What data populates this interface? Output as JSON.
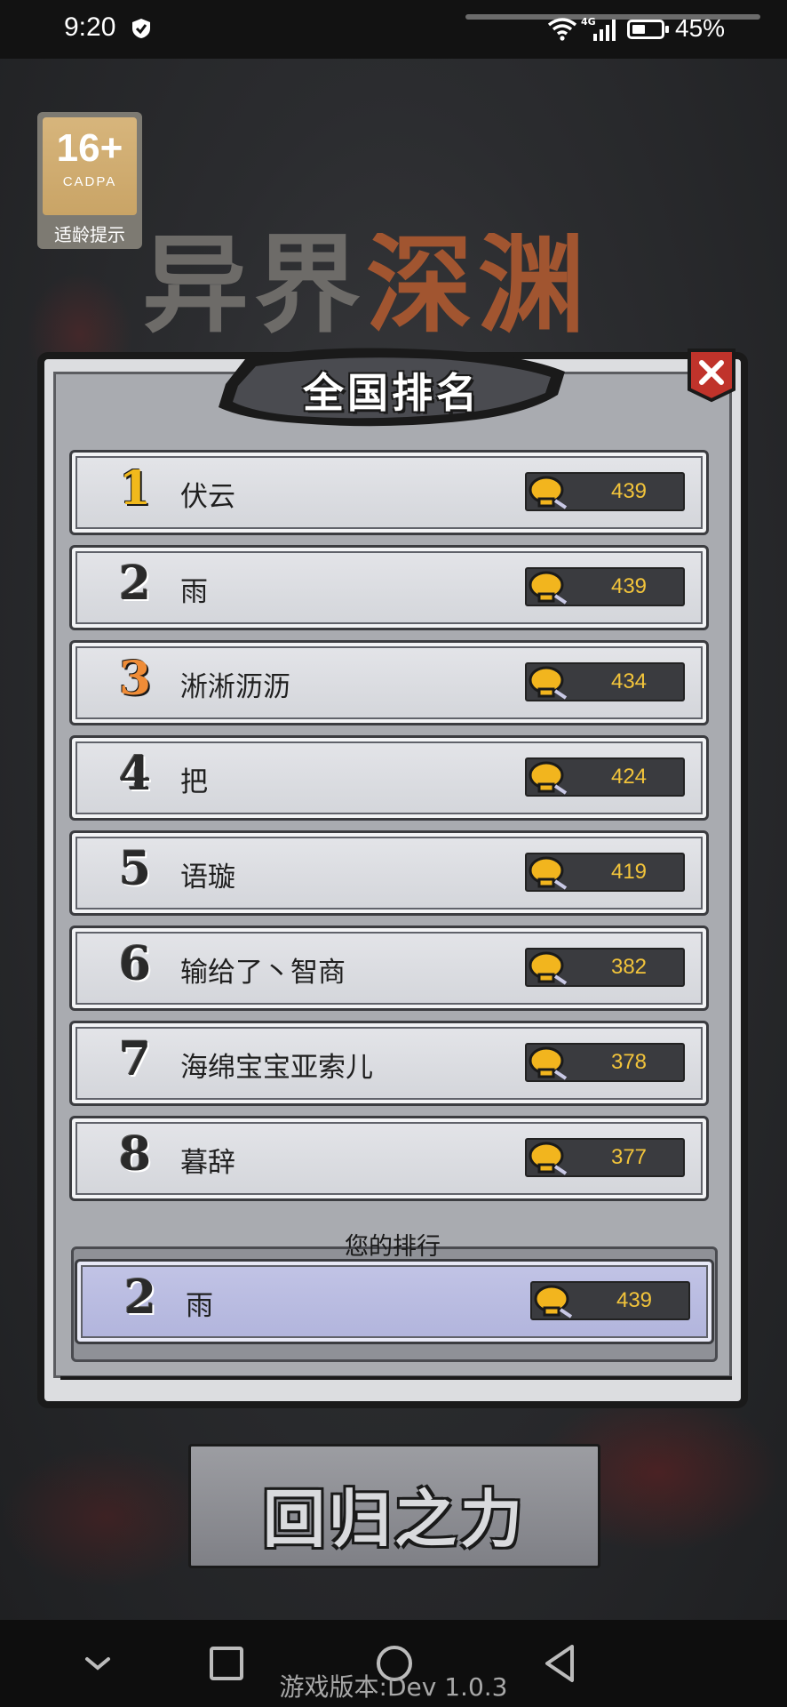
{
  "status_bar": {
    "time": "9:20",
    "network": "4G",
    "battery_pct": "45%",
    "battery_level": 0.45
  },
  "age_rating": {
    "age": "16+",
    "org": "CADPA",
    "hint": "适龄提示"
  },
  "game_title": {
    "part1": "异界",
    "part2": "深渊"
  },
  "panel": {
    "title": "全国排名",
    "close_icon": "close-x-icon"
  },
  "leaderboard": [
    {
      "rank": "1",
      "name": "伏云",
      "score": "439"
    },
    {
      "rank": "2",
      "name": "雨",
      "score": "439"
    },
    {
      "rank": "3",
      "name": "淅淅沥沥",
      "score": "434"
    },
    {
      "rank": "4",
      "name": "把",
      "score": "424"
    },
    {
      "rank": "5",
      "name": "语璇",
      "score": "419"
    },
    {
      "rank": "6",
      "name": "输给了丶智商",
      "score": "382"
    },
    {
      "rank": "7",
      "name": "海绵宝宝亚索儿",
      "score": "378"
    },
    {
      "rank": "8",
      "name": "暮辞",
      "score": "377"
    }
  ],
  "your_rank": {
    "label": "您的排行",
    "rank": "2",
    "name": "雨",
    "score": "439"
  },
  "return_button": {
    "label": "回归之力"
  },
  "version": "游戏版本:Dev 1.0.3",
  "colors": {
    "gold_rank": "#f1b91c",
    "bronze_rank": "#ef8c37",
    "score_text": "#f2c43b",
    "highlight_row": "#b1b4dc",
    "close_red": "#c0332b"
  }
}
